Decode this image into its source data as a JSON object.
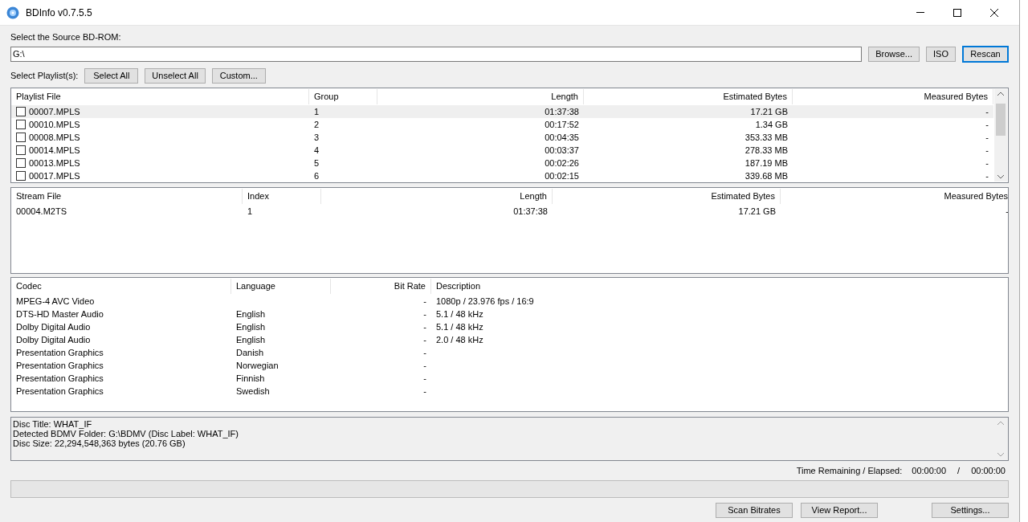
{
  "window": {
    "title": "BDInfo v0.7.5.5"
  },
  "source": {
    "label": "Select the Source BD-ROM:",
    "value": "G:\\",
    "buttons": [
      {
        "label": "Browse...",
        "default": false
      },
      {
        "label": "ISO",
        "default": false
      },
      {
        "label": "Rescan",
        "default": true
      }
    ]
  },
  "playlist_bar": {
    "label": "Select Playlist(s):",
    "buttons": [
      "Select All",
      "Unselect All",
      "Custom..."
    ]
  },
  "playlists": {
    "columns": [
      "Playlist File",
      "Group",
      "Length",
      "Estimated Bytes",
      "Measured Bytes"
    ],
    "rows": [
      {
        "file": "00007.MPLS",
        "group": "1",
        "length": "01:37:38",
        "estimated": "17.21 GB",
        "measured": "-",
        "checked": false,
        "selected": true
      },
      {
        "file": "00010.MPLS",
        "group": "2",
        "length": "00:17:52",
        "estimated": "1.34 GB",
        "measured": "-",
        "checked": false,
        "selected": false
      },
      {
        "file": "00008.MPLS",
        "group": "3",
        "length": "00:04:35",
        "estimated": "353.33 MB",
        "measured": "-",
        "checked": false,
        "selected": false
      },
      {
        "file": "00014.MPLS",
        "group": "4",
        "length": "00:03:37",
        "estimated": "278.33 MB",
        "measured": "-",
        "checked": false,
        "selected": false
      },
      {
        "file": "00013.MPLS",
        "group": "5",
        "length": "00:02:26",
        "estimated": "187.19 MB",
        "measured": "-",
        "checked": false,
        "selected": false
      },
      {
        "file": "00017.MPLS",
        "group": "6",
        "length": "00:02:15",
        "estimated": "339.68 MB",
        "measured": "-",
        "checked": false,
        "selected": false
      }
    ]
  },
  "streams": {
    "columns": [
      "Stream File",
      "Index",
      "Length",
      "Estimated Bytes",
      "Measured Bytes"
    ],
    "rows": [
      {
        "file": "00004.M2TS",
        "index": "1",
        "length": "01:37:38",
        "estimated": "17.21 GB",
        "measured": "-"
      }
    ]
  },
  "codecs": {
    "columns": [
      "Codec",
      "Language",
      "Bit Rate",
      "Description"
    ],
    "rows": [
      {
        "codec": "MPEG-4 AVC Video",
        "language": "",
        "bitrate": "-",
        "description": "1080p / 23.976 fps / 16:9"
      },
      {
        "codec": "DTS-HD Master Audio",
        "language": "English",
        "bitrate": "-",
        "description": "5.1 / 48 kHz"
      },
      {
        "codec": "Dolby Digital Audio",
        "language": "English",
        "bitrate": "-",
        "description": "5.1 / 48 kHz"
      },
      {
        "codec": "Dolby Digital Audio",
        "language": "English",
        "bitrate": "-",
        "description": "2.0 / 48 kHz"
      },
      {
        "codec": "Presentation Graphics",
        "language": "Danish",
        "bitrate": "-",
        "description": ""
      },
      {
        "codec": "Presentation Graphics",
        "language": "Norwegian",
        "bitrate": "-",
        "description": ""
      },
      {
        "codec": "Presentation Graphics",
        "language": "Finnish",
        "bitrate": "-",
        "description": ""
      },
      {
        "codec": "Presentation Graphics",
        "language": "Swedish",
        "bitrate": "-",
        "description": ""
      }
    ]
  },
  "info": [
    "Disc Title: WHAT_IF",
    "Detected BDMV Folder: G:\\BDMV (Disc Label: WHAT_IF)",
    "Disc Size: 22,294,548,363 bytes (20.76 GB)"
  ],
  "time": {
    "label": "Time Remaining / Elapsed:",
    "remaining": "00:00:00",
    "separator": "/",
    "elapsed": "00:00:00"
  },
  "progress": {
    "level": 0
  },
  "bottom_buttons": [
    "Scan Bitrates",
    "View Report...",
    "Settings..."
  ]
}
